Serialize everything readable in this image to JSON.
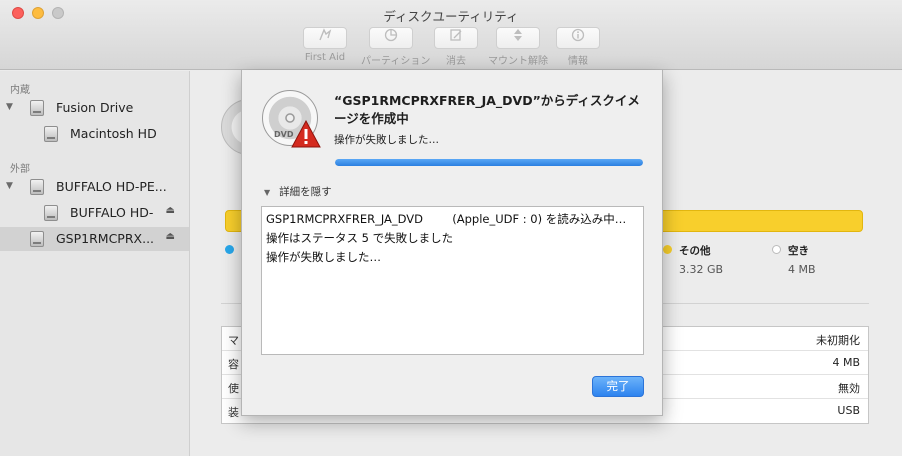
{
  "window": {
    "title": "ディスクユーティリティ"
  },
  "toolbar": {
    "items": [
      {
        "label": "First Aid",
        "icon": "first-aid-icon"
      },
      {
        "label": "パーティション",
        "icon": "partition-icon"
      },
      {
        "label": "消去",
        "icon": "erase-icon"
      },
      {
        "label": "マウント解除",
        "icon": "unmount-icon"
      },
      {
        "label": "情報",
        "icon": "info-icon"
      }
    ]
  },
  "sidebar": {
    "internal_header": "内蔵",
    "external_header": "外部",
    "items": [
      {
        "label": "Fusion Drive"
      },
      {
        "label": "Macintosh HD"
      },
      {
        "label": "BUFFALO HD-PE..."
      },
      {
        "label": "BUFFALO HD-"
      },
      {
        "label": "GSP1RMCPRX..."
      }
    ]
  },
  "main": {
    "usage_colors": {
      "other": "#f8cf2c",
      "free": "#ffffff",
      "used": "#28a7ea"
    },
    "legend": [
      {
        "name": "その他",
        "size": "3.32 GB",
        "color": "#f8cf2c"
      },
      {
        "name": "空き",
        "size": "4 MB",
        "color": "#ffffff"
      }
    ],
    "info": [
      {
        "key": "マ",
        "value": "未初期化"
      },
      {
        "key": "容",
        "value": "4 MB"
      },
      {
        "key": "使",
        "value": "無効"
      },
      {
        "key": "装",
        "value": "USB"
      }
    ]
  },
  "sheet": {
    "title": "“GSP1RMCPRXFRER_JA_DVD”からディスクイメージを作成中",
    "status": "操作が失敗しました…",
    "progress": 1.0,
    "details_label": "詳細を隠す",
    "log": [
      "GSP1RMCPRXFRER_JA_DVD        (Apple_UDF : 0) を読み込み中…",
      "操作はステータス 5 で失敗しました",
      "操作が失敗しました…"
    ],
    "done_label": "完了"
  }
}
